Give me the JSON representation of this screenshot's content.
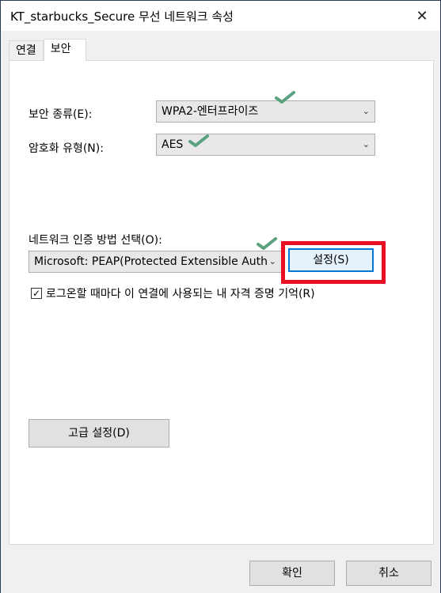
{
  "window": {
    "title": "KT_starbucks_Secure 무선 네트워크 속성",
    "close": "✕"
  },
  "tabs": [
    {
      "label": "연결"
    },
    {
      "label": "보안"
    }
  ],
  "security": {
    "type_label": "보안 종류(E):",
    "type_value": "WPA2-엔터프라이즈",
    "encryption_label": "암호화 유형(N):",
    "encryption_value": "AES",
    "auth_label": "네트워크 인증 방법 선택(O):",
    "auth_value": "Microsoft: PEAP(Protected Extensible Authe",
    "settings_button": "설정(S)",
    "remember_label": "로그온할 때마다 이 연결에 사용되는 내 자격 증명 기억(R)",
    "remember_checked": "✓",
    "advanced_button": "고급 설정(D)"
  },
  "footer": {
    "ok": "확인",
    "cancel": "취소"
  },
  "icons": {
    "dropdown": "chevron-down-icon",
    "annotation": "green-checkmark-icon"
  },
  "colors": {
    "highlight": "#e81123",
    "checkmark": "#5aa17f"
  }
}
